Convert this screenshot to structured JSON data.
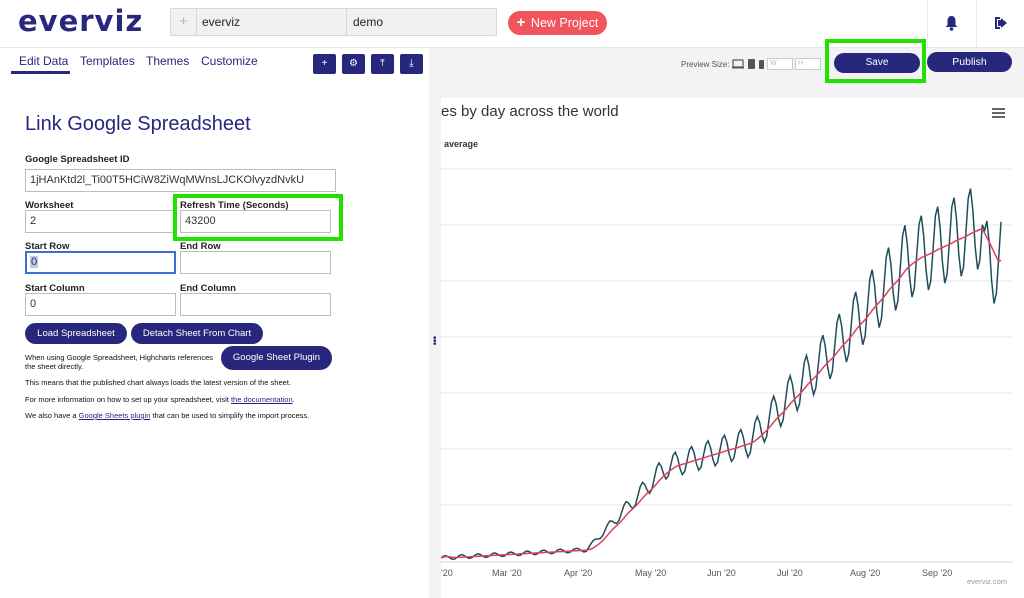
{
  "app": {
    "logo": "everviz"
  },
  "breadcrumb": {
    "plus": "+",
    "team": "everviz",
    "project": "demo"
  },
  "new_project": {
    "label": "New Project",
    "plus": "+"
  },
  "tabs": [
    {
      "label": "Edit Data",
      "active": true
    },
    {
      "label": "Templates"
    },
    {
      "label": "Themes"
    },
    {
      "label": "Customize"
    }
  ],
  "toolbar": {
    "buttons": [
      {
        "icon": "plus-icon",
        "glyph": "+"
      },
      {
        "icon": "gear-icon",
        "glyph": "⚙"
      },
      {
        "icon": "upload-icon",
        "glyph": "⤒"
      },
      {
        "icon": "download-icon",
        "glyph": "⤓"
      }
    ]
  },
  "form": {
    "title": "Link Google Spreadsheet",
    "spreadsheet_id_label": "Google Spreadsheet ID",
    "spreadsheet_id_value": "1jHAnKtd2l_Ti00T5HCiW8ZiWqMWnsLJCKOlvyzdNvkU",
    "worksheet_label": "Worksheet",
    "worksheet_value": "2",
    "refresh_label": "Refresh Time (Seconds)",
    "refresh_value": "43200",
    "start_row_label": "Start Row",
    "start_row_value": "0",
    "end_row_label": "End Row",
    "end_row_value": "",
    "start_col_label": "Start Column",
    "start_col_value": "0",
    "end_col_label": "End Column",
    "end_col_value": "",
    "load_button": "Load Spreadsheet",
    "detach_button": "Detach Sheet From Chart",
    "plugin_button": "Google Sheet Plugin",
    "info1": "When using Google Spreadsheet, Highcharts references the sheet directly.",
    "info2": "This means that the published chart always loads the latest version of the sheet.",
    "info3_prefix": "For more information on how to set up your spreadsheet, visit ",
    "info3_link": "the documentation",
    "info3_suffix": ".",
    "info4_prefix": "We also have a ",
    "info4_link": "Google Sheets plugin",
    "info4_suffix": " that can be used to simplify the import process."
  },
  "preview": {
    "label": "Preview Size:",
    "w_placeholder": "W",
    "h_placeholder": "H"
  },
  "actions": {
    "save": "Save",
    "publish": "Publish"
  },
  "chart": {
    "title": "es by day across the world",
    "legend": "average",
    "credit": "everviz.com",
    "menu_icon": "hamburger-menu-icon"
  },
  "chart_data": {
    "type": "line",
    "x_ticks": [
      "'20",
      "Mar '20",
      "Apr '20",
      "May '20",
      "Jun '20",
      "Jul '20",
      "Aug '20",
      "Sep '20"
    ],
    "series": [
      {
        "color": "#1f4e5a"
      },
      {
        "name": "average",
        "color": "#e0405a"
      }
    ],
    "grid": true
  }
}
